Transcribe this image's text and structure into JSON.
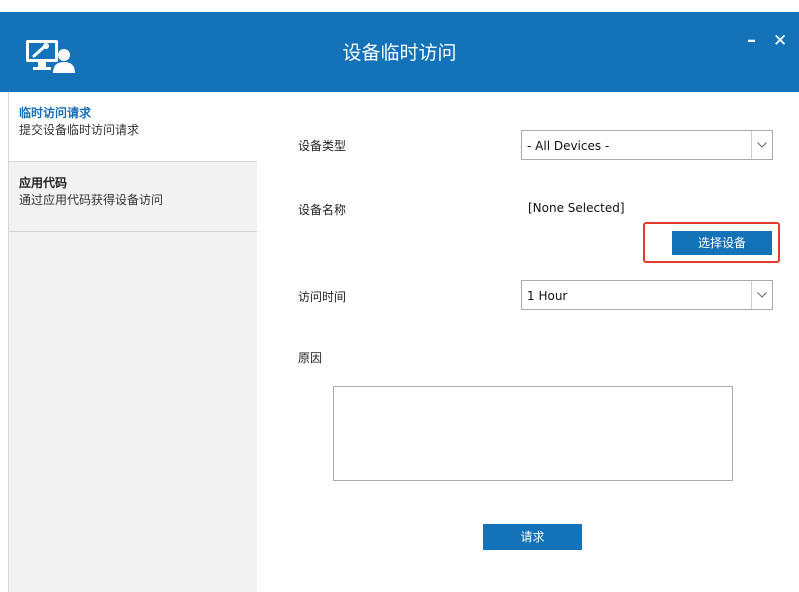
{
  "window": {
    "title": "设备临时访问",
    "minimize_glyph": "–",
    "close_glyph": "✕",
    "logo_icon": "remote-access-logo-icon"
  },
  "colors": {
    "header": "#1472b8",
    "button": "#1472b8",
    "highlight_border": "#e53a2f",
    "active_nav_title": "#1a6fb3"
  },
  "sidebar": {
    "items": [
      {
        "title": "临时访问请求",
        "subtitle": "提交设备临时访问请求",
        "active": true
      },
      {
        "title": "应用代码",
        "subtitle": "通过应用代码获得设备访问",
        "active": false
      }
    ]
  },
  "form": {
    "device_type": {
      "label": "设备类型",
      "value": "- All Devices -"
    },
    "device_name": {
      "label": "设备名称",
      "value": "[None Selected]"
    },
    "select_device_button": "选择设备",
    "access_time": {
      "label": "访问时间",
      "value": "1 Hour"
    },
    "reason": {
      "label": "原因",
      "value": ""
    },
    "submit_button": "请求"
  }
}
